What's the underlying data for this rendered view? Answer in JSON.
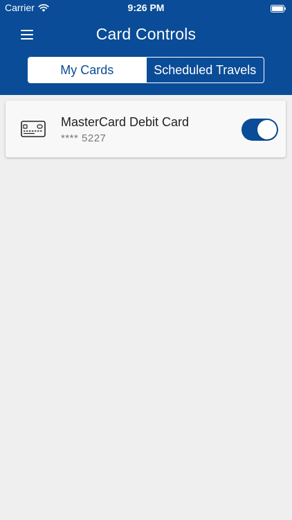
{
  "status_bar": {
    "carrier": "Carrier",
    "time": "9:26 PM"
  },
  "header": {
    "title": "Card Controls",
    "background_color": "#0a4c97"
  },
  "tabs": [
    {
      "label": "My Cards",
      "selected": true
    },
    {
      "label": "Scheduled Travels",
      "selected": false
    }
  ],
  "cards": [
    {
      "icon": "credit-card-icon",
      "name": "MasterCard Debit Card",
      "number": "**** 5227",
      "enabled": true
    }
  ],
  "colors": {
    "accent": "#0a4c97",
    "background": "#efefef"
  }
}
